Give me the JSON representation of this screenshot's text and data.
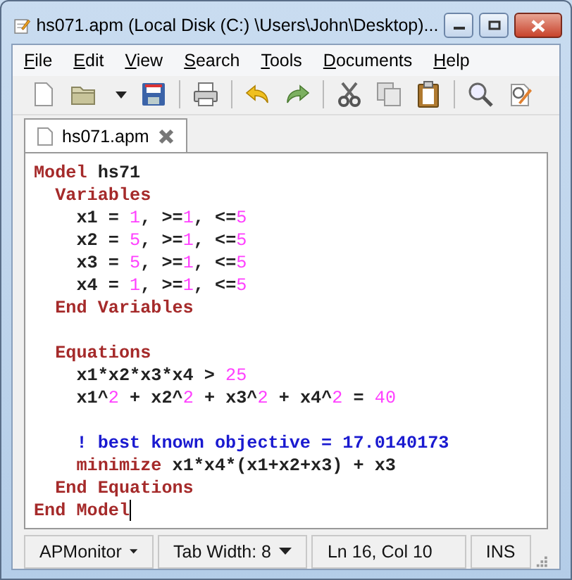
{
  "window": {
    "title": "hs071.apm (Local Disk (C:) \\Users\\John\\Desktop)..."
  },
  "menu": [
    "File",
    "Edit",
    "View",
    "Search",
    "Tools",
    "Documents",
    "Help"
  ],
  "tabs": [
    {
      "label": "hs071.apm",
      "selected": true
    }
  ],
  "editor": {
    "lines": [
      {
        "cursor": false,
        "tokens": [
          {
            "kind": "keyword",
            "text": "Model"
          },
          {
            "kind": "plain",
            "text": " hs71"
          }
        ]
      },
      {
        "cursor": false,
        "tokens": [
          {
            "kind": "keyword",
            "text": "  Variables"
          }
        ]
      },
      {
        "cursor": false,
        "tokens": [
          {
            "kind": "plain",
            "text": "    x1 = "
          },
          {
            "kind": "number",
            "text": "1"
          },
          {
            "kind": "plain",
            "text": ", >="
          },
          {
            "kind": "number",
            "text": "1"
          },
          {
            "kind": "plain",
            "text": ", <="
          },
          {
            "kind": "number",
            "text": "5"
          }
        ]
      },
      {
        "cursor": false,
        "tokens": [
          {
            "kind": "plain",
            "text": "    x2 = "
          },
          {
            "kind": "number",
            "text": "5"
          },
          {
            "kind": "plain",
            "text": ", >="
          },
          {
            "kind": "number",
            "text": "1"
          },
          {
            "kind": "plain",
            "text": ", <="
          },
          {
            "kind": "number",
            "text": "5"
          }
        ]
      },
      {
        "cursor": false,
        "tokens": [
          {
            "kind": "plain",
            "text": "    x3 = "
          },
          {
            "kind": "number",
            "text": "5"
          },
          {
            "kind": "plain",
            "text": ", >="
          },
          {
            "kind": "number",
            "text": "1"
          },
          {
            "kind": "plain",
            "text": ", <="
          },
          {
            "kind": "number",
            "text": "5"
          }
        ]
      },
      {
        "cursor": false,
        "tokens": [
          {
            "kind": "plain",
            "text": "    x4 = "
          },
          {
            "kind": "number",
            "text": "1"
          },
          {
            "kind": "plain",
            "text": ", >="
          },
          {
            "kind": "number",
            "text": "1"
          },
          {
            "kind": "plain",
            "text": ", <="
          },
          {
            "kind": "number",
            "text": "5"
          }
        ]
      },
      {
        "cursor": false,
        "tokens": [
          {
            "kind": "keyword",
            "text": "  End Variables"
          }
        ]
      },
      {
        "kind": "blank"
      },
      {
        "cursor": false,
        "tokens": [
          {
            "kind": "keyword",
            "text": "  Equations"
          }
        ]
      },
      {
        "cursor": false,
        "tokens": [
          {
            "kind": "plain",
            "text": "    x1*x2*x3*x4 > "
          },
          {
            "kind": "number",
            "text": "25"
          }
        ]
      },
      {
        "cursor": false,
        "tokens": [
          {
            "kind": "plain",
            "text": "    x1^"
          },
          {
            "kind": "number",
            "text": "2"
          },
          {
            "kind": "plain",
            "text": " + x2^"
          },
          {
            "kind": "number",
            "text": "2"
          },
          {
            "kind": "plain",
            "text": " + x3^"
          },
          {
            "kind": "number",
            "text": "2"
          },
          {
            "kind": "plain",
            "text": " + x4^"
          },
          {
            "kind": "number",
            "text": "2"
          },
          {
            "kind": "plain",
            "text": " = "
          },
          {
            "kind": "number",
            "text": "40"
          }
        ]
      },
      {
        "kind": "blank"
      },
      {
        "cursor": false,
        "tokens": [
          {
            "kind": "comment",
            "text": "    ! best known objective = 17.0140173"
          }
        ]
      },
      {
        "cursor": false,
        "tokens": [
          {
            "kind": "keyword",
            "text": "    minimize"
          },
          {
            "kind": "plain",
            "text": " x1*x4*(x1+x2+x3) + x3"
          }
        ]
      },
      {
        "cursor": false,
        "tokens": [
          {
            "kind": "keyword",
            "text": "  End Equations"
          }
        ]
      },
      {
        "cursor": true,
        "tokens": [
          {
            "kind": "keyword",
            "text": "End Model"
          }
        ]
      }
    ]
  },
  "status_bar": [
    {
      "kind": "dropdown",
      "label": "APMonitor"
    },
    {
      "kind": "dropdown",
      "label": "Tab Width: 8"
    },
    {
      "kind": "text",
      "label": "Ln 16, Col 10"
    },
    {
      "kind": "text",
      "label": "INS"
    }
  ]
}
